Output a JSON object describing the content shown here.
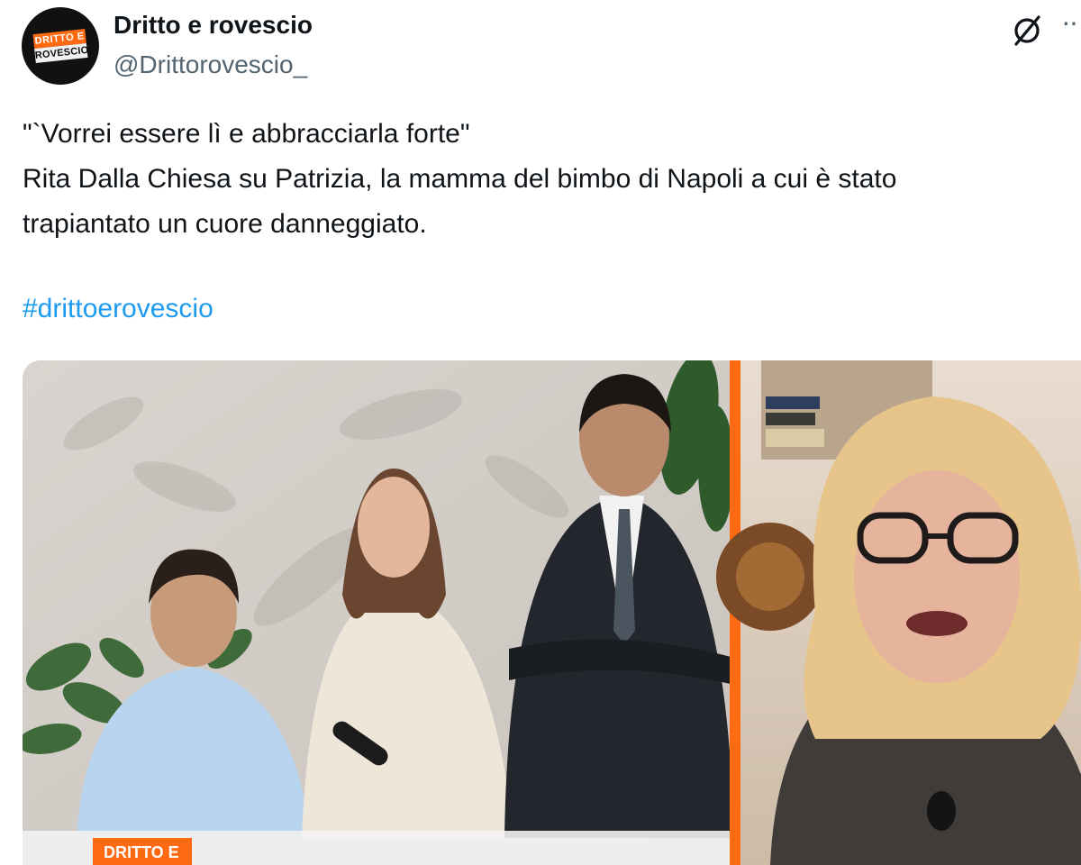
{
  "author": {
    "name": "Dritto e rovescio",
    "handle": "@Drittorovescio_",
    "avatar_logo": {
      "top": "DRITTO E",
      "bottom": "ROVESCIO"
    }
  },
  "icons": {
    "grok": "grok-icon",
    "more": "more-icon"
  },
  "tweet": {
    "lines": [
      "\"`Vorrei essere lì e abbracciarla forte\"",
      "Rita Dalla Chiesa su Patrizia, la mamma del bimbo di Napoli a cui è stato",
      "trapiantato un cuore danneggiato."
    ],
    "hashtag": "#drittoerovescio"
  },
  "media": {
    "type": "video-still",
    "bottom_banner": "DRITTO E"
  },
  "colors": {
    "accent": "#1d9bf0",
    "brand_orange": "#ff6a13",
    "text": "#0f1419",
    "muted": "#536471"
  }
}
